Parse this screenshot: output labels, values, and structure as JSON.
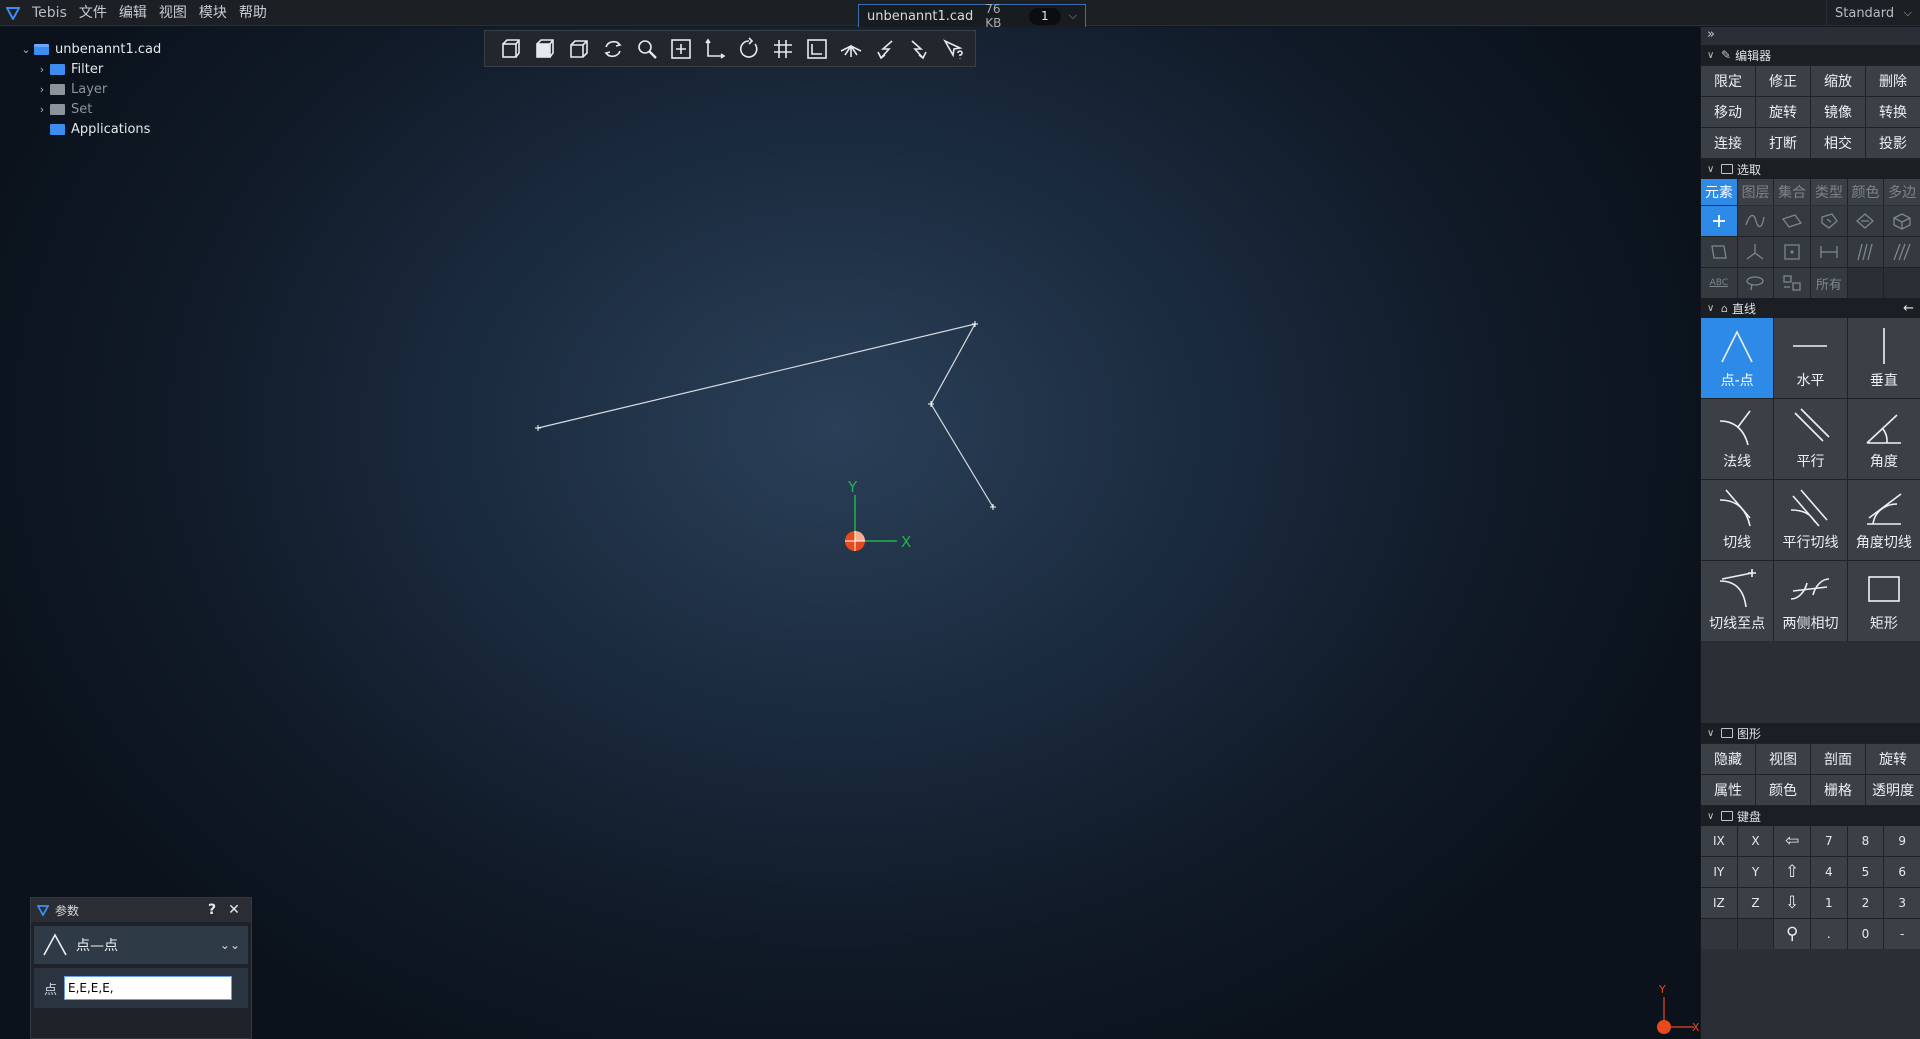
{
  "menubar": {
    "app_name": "Tebis",
    "menus": [
      "文件",
      "编辑",
      "视图",
      "模块",
      "帮助"
    ],
    "profile": "Standard"
  },
  "doc_tab": {
    "filename": "unbenannt1.cad",
    "size": "76 KB",
    "count": "1"
  },
  "tree": {
    "root": "unbenannt1.cad",
    "children": [
      "Filter",
      "Layer",
      "Set",
      "Applications"
    ]
  },
  "toolbar": {
    "icons": [
      "cube-front-icon",
      "cube-shaded-icon",
      "cube-iso-icon",
      "rotate-view-icon",
      "zoom-icon",
      "fit-icon",
      "axis-icon",
      "refresh-icon",
      "grid-icon",
      "frame-icon",
      "ray-icon",
      "undo-icon",
      "redo-icon",
      "cursor-help-icon"
    ]
  },
  "viewport": {
    "axis_y": "Y",
    "axis_x": "X"
  },
  "params": {
    "title": "参数",
    "help": "?",
    "close": "✕",
    "command": "点—点",
    "field_label": "点",
    "field_value": "E,E,E,E,"
  },
  "rpanel": {
    "collapse": "»",
    "editor": {
      "title": "编辑器",
      "buttons": [
        "限定",
        "修正",
        "缩放",
        "删除",
        "移动",
        "旋转",
        "镜像",
        "转换",
        "连接",
        "打断",
        "相交",
        "投影"
      ]
    },
    "select": {
      "title": "选取",
      "tabs": [
        "元素",
        "图层",
        "集合",
        "类型",
        "颜色",
        "多边"
      ],
      "abc": "ABC",
      "all": "所有"
    },
    "lines": {
      "title": "直线",
      "back": "←",
      "buttons": [
        "点-点",
        "水平",
        "垂直",
        "法线",
        "平行",
        "角度",
        "切线",
        "平行切线",
        "角度切线",
        "切线至点",
        "两侧相切",
        "矩形"
      ]
    },
    "graphics": {
      "title": "图形",
      "buttons": [
        "隐藏",
        "视图",
        "剖面",
        "旋转",
        "属性",
        "颜色",
        "栅格",
        "透明度"
      ]
    },
    "keyboard": {
      "title": "键盘",
      "keys": [
        "IX",
        "X",
        "⇦",
        "7",
        "8",
        "9",
        "IY",
        "Y",
        "⇧",
        "4",
        "5",
        "6",
        "IZ",
        "Z",
        "⇩",
        "1",
        "2",
        "3",
        "",
        "",
        "⚲",
        ".",
        "0",
        "-"
      ]
    }
  },
  "colors": {
    "accent": "#2d8ae6",
    "axis_y": "#22b34a",
    "axis_x": "#22b34a",
    "origin": "#e8491d"
  }
}
